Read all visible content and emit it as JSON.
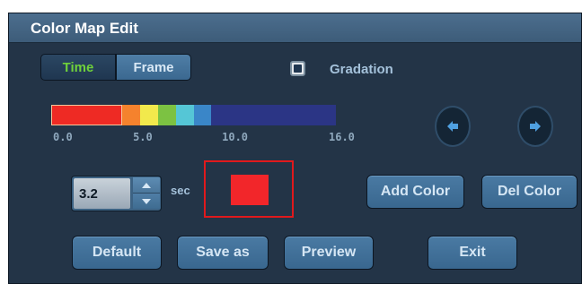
{
  "window": {
    "title": "Color Map Edit"
  },
  "mode": {
    "time_label": "Time",
    "frame_label": "Frame",
    "selected": "Time"
  },
  "gradation": {
    "label": "Gradation",
    "checked": true
  },
  "color_bar": {
    "segments": [
      {
        "color": "#ee2a24",
        "start": 0.0,
        "end": 4.0
      },
      {
        "color": "#f5822d",
        "start": 4.0,
        "end": 5.0
      },
      {
        "color": "#f2e94c",
        "start": 5.0,
        "end": 6.0
      },
      {
        "color": "#7cc242",
        "start": 6.0,
        "end": 7.0
      },
      {
        "color": "#55c6d6",
        "start": 7.0,
        "end": 8.0
      },
      {
        "color": "#3a86c8",
        "start": 8.0,
        "end": 9.0
      },
      {
        "color": "#2b3585",
        "start": 9.0,
        "end": 16.0
      }
    ],
    "selected_segment": 0,
    "ticks": [
      "0.0",
      "5.0",
      "10.0",
      "16.0"
    ],
    "range": [
      0,
      16
    ]
  },
  "navigation": {
    "prev_icon": "arrow-left-icon",
    "next_icon": "arrow-right-icon"
  },
  "time_input": {
    "value": "3.2",
    "unit": "sec"
  },
  "current_color": {
    "color": "#f2262a"
  },
  "buttons": {
    "add_color": "Add Color",
    "del_color": "Del Color",
    "default": "Default",
    "save_as": "Save as",
    "preview": "Preview",
    "exit": "Exit"
  },
  "colors": {
    "panel": "#233447",
    "title_bar": "#44657f",
    "button": "#3f6d94",
    "accent_green": "#6fd13a",
    "highlight_red": "#e0191c"
  }
}
